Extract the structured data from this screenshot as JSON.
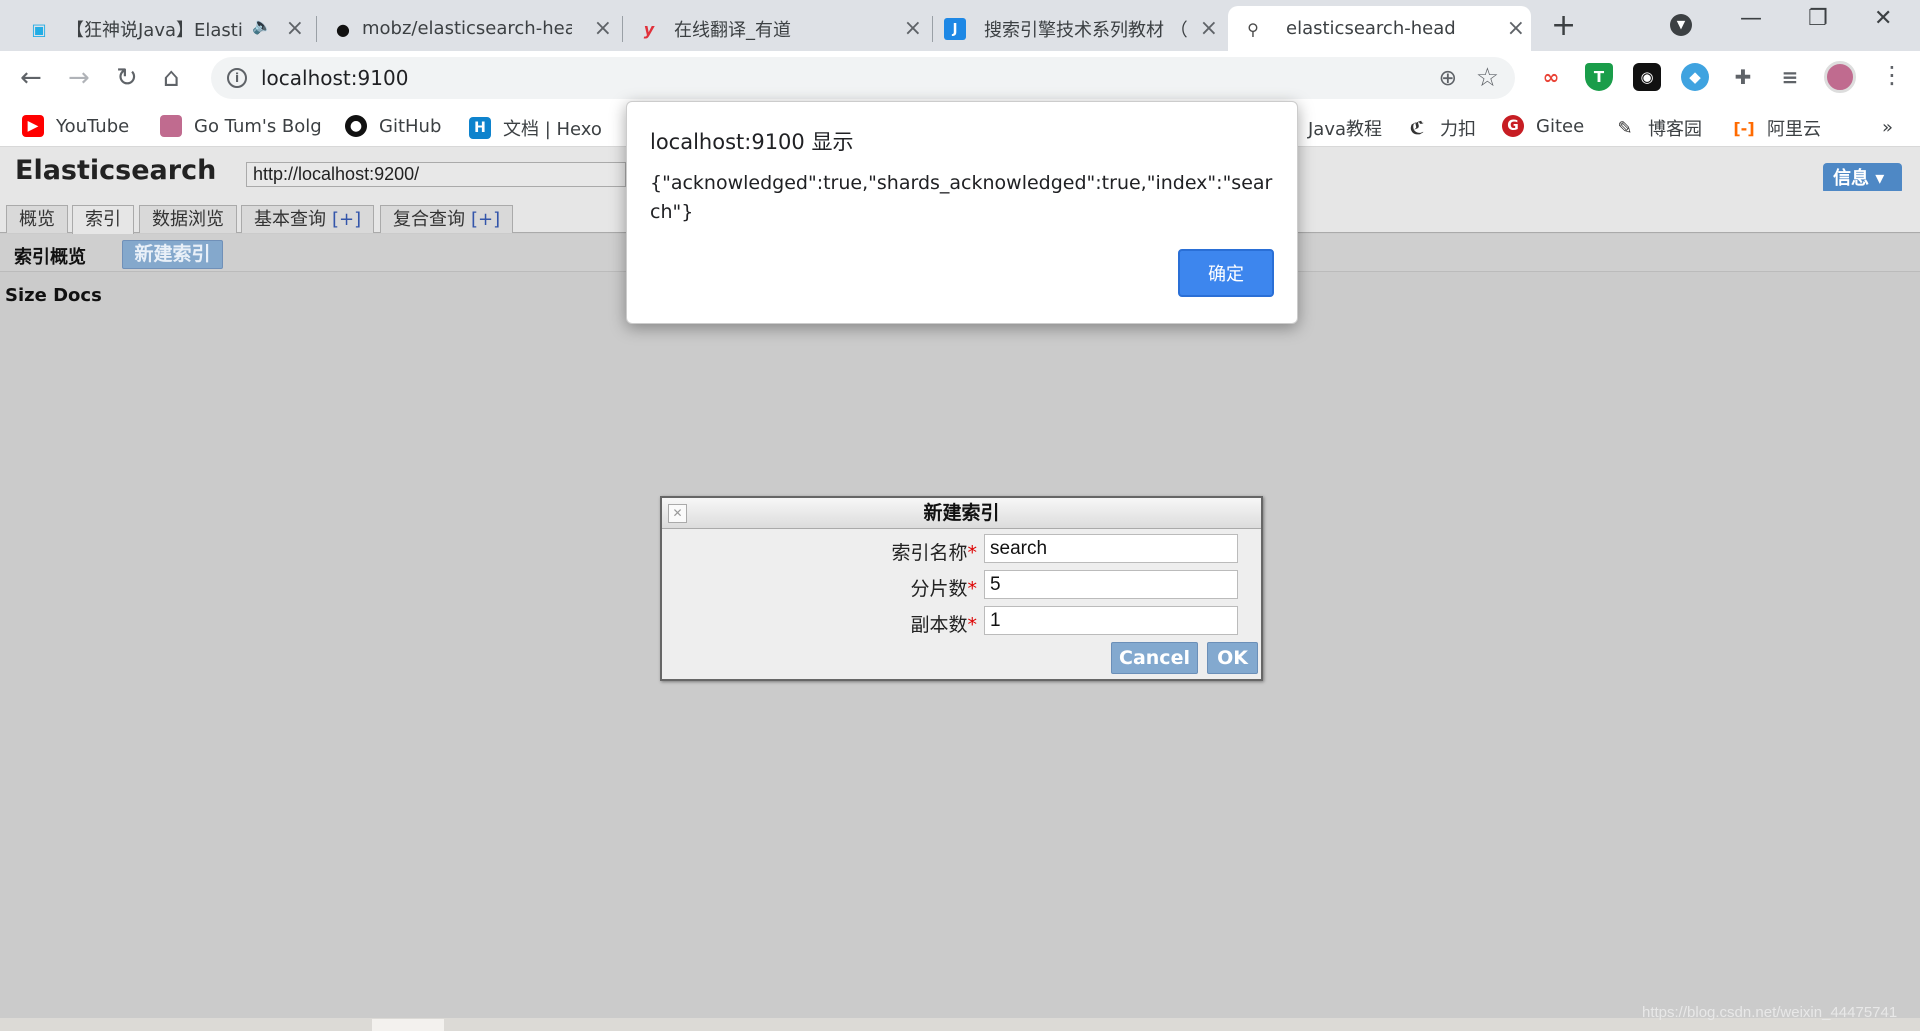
{
  "browser": {
    "tabs": [
      {
        "title": "【狂神说Java】Elasti",
        "favicon": "bilibili-icon"
      },
      {
        "title": "mobz/elasticsearch-hea",
        "favicon": "github-icon"
      },
      {
        "title": "在线翻译_有道",
        "favicon": "youdao-icon"
      },
      {
        "title": "搜索引擎技术系列教材 （",
        "favicon": "how2j-icon"
      },
      {
        "title": "elasticsearch-head",
        "favicon": "elasticsearch-head-icon"
      }
    ],
    "url": "localhost:9100",
    "bookmarks": [
      {
        "label": "YouTube",
        "icon": "youtube-icon"
      },
      {
        "label": "Go Tum's Bolg",
        "icon": "blog-icon"
      },
      {
        "label": "GitHub",
        "icon": "github-icon"
      },
      {
        "label": "文档 | Hexo",
        "icon": "hexo-icon"
      },
      {
        "label": "Java教程",
        "icon": "java-icon"
      },
      {
        "label": "力扣",
        "icon": "leetcode-icon"
      },
      {
        "label": "Gitee",
        "icon": "gitee-icon"
      },
      {
        "label": "博客园",
        "icon": "cnblogs-icon"
      },
      {
        "label": "阿里云",
        "icon": "aliyun-icon"
      }
    ]
  },
  "es": {
    "brand": "Elasticsearch",
    "cluster_url": "http://localhost:9200/",
    "info_button": "信息 ▾",
    "tabs": [
      {
        "label": "概览"
      },
      {
        "label": "索引"
      },
      {
        "label": "数据浏览"
      },
      {
        "label": "基本查询",
        "plus": "[+]"
      },
      {
        "label": "复合查询",
        "plus": "[+]"
      }
    ],
    "sub_label": "索引概览",
    "new_index_button": "新建索引",
    "size_docs": "Size Docs"
  },
  "dialog": {
    "title": "新建索引",
    "fields": [
      {
        "label": "索引名称",
        "value": "search"
      },
      {
        "label": "分片数",
        "value": "5"
      },
      {
        "label": "副本数",
        "value": "1"
      }
    ],
    "required_mark": "*",
    "cancel": "Cancel",
    "ok": "OK"
  },
  "alert": {
    "title": "localhost:9100 显示",
    "message": "{\"acknowledged\":true,\"shards_acknowledged\":true,\"index\":\"search\"}",
    "ok": "确定"
  },
  "watermark": "https://blog.csdn.net/weixin_44475741",
  "colors": {
    "accent": "#3d86ee",
    "es_button": "#84a8cc",
    "page_bg": "#cbcbcb"
  }
}
